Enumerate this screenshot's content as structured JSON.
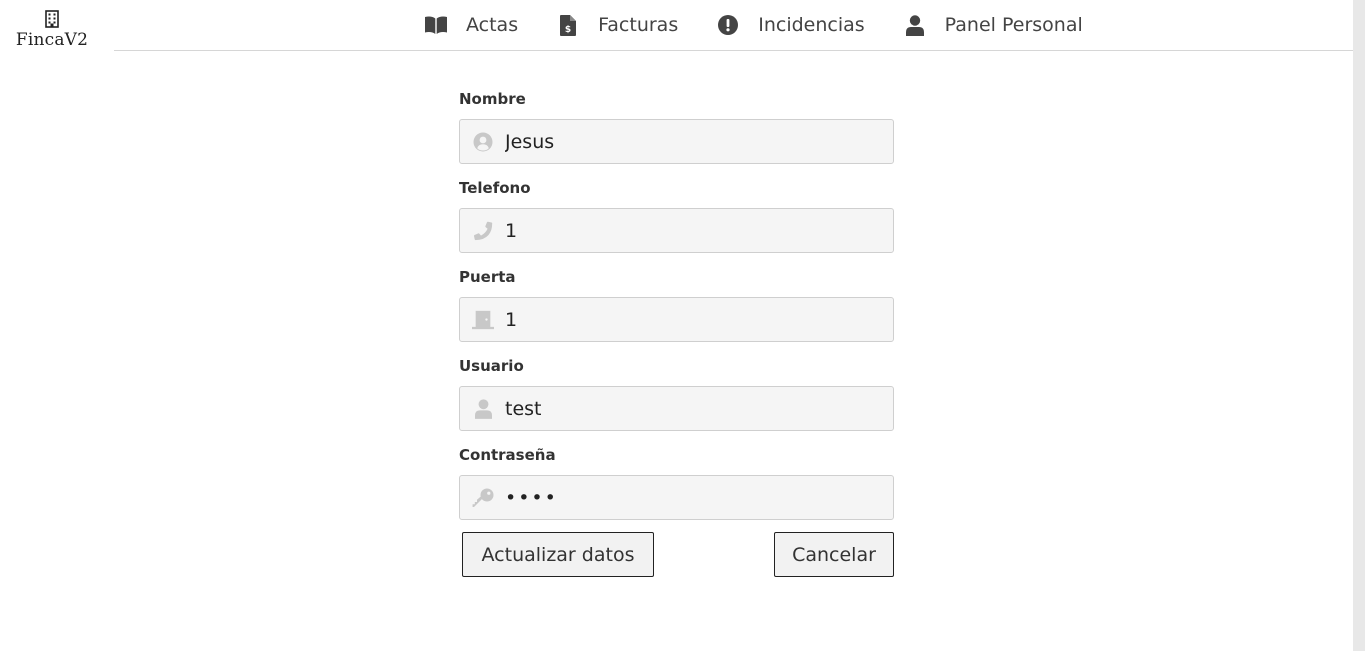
{
  "brand": {
    "name": "FincaV2",
    "icon": "building-icon"
  },
  "nav": {
    "items": [
      {
        "label": "Actas",
        "icon": "book-open-icon"
      },
      {
        "label": "Facturas",
        "icon": "invoice-file-icon"
      },
      {
        "label": "Incidencias",
        "icon": "exclamation-circle-icon"
      },
      {
        "label": "Panel Personal",
        "icon": "user-icon"
      }
    ]
  },
  "form": {
    "nombre": {
      "label": "Nombre",
      "value": "Jesus",
      "icon": "user-circle-icon"
    },
    "telefono": {
      "label": "Telefono",
      "value": "1",
      "icon": "phone-icon"
    },
    "puerta": {
      "label": "Puerta",
      "value": "1",
      "icon": "door-icon"
    },
    "usuario": {
      "label": "Usuario",
      "value": "test",
      "icon": "user-icon"
    },
    "contrasena": {
      "label": "Contraseña",
      "value": "test",
      "icon": "key-icon"
    }
  },
  "buttons": {
    "update_label": "Actualizar datos",
    "cancel_label": "Cancelar"
  },
  "colors": {
    "icon_muted": "#c8c8c8",
    "nav_icon": "#444444",
    "input_bg": "#f5f5f5"
  }
}
